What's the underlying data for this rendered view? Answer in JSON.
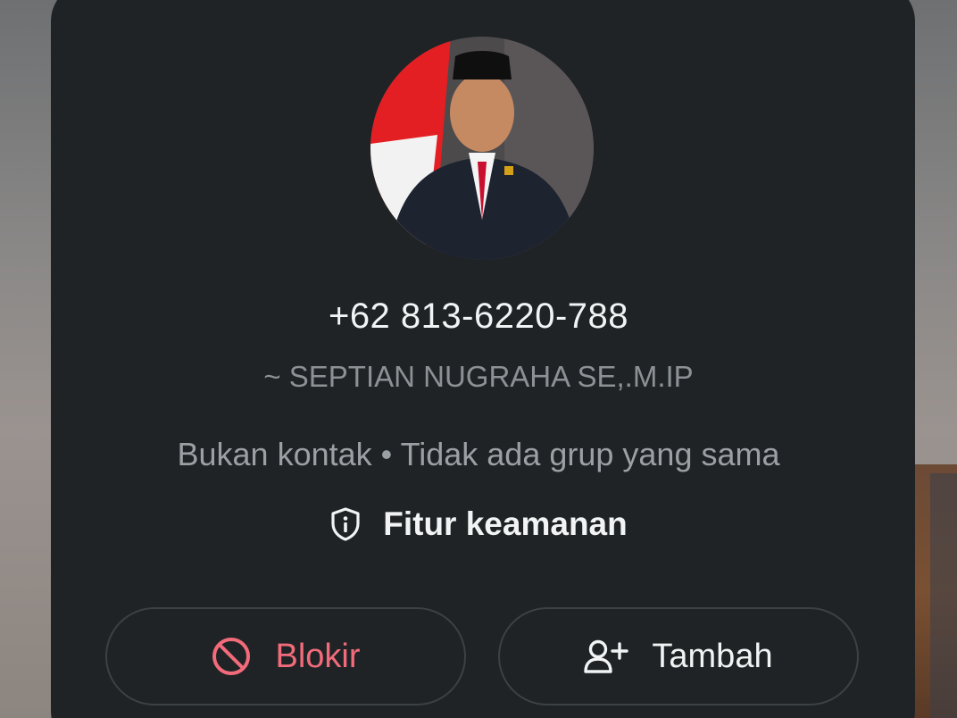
{
  "contact": {
    "phone": "+62 813-6220-788",
    "push_name": "~ SEPTIAN NUGRAHA SE,.M.IP",
    "status_line": "Bukan kontak • Tidak ada grup yang sama"
  },
  "security": {
    "label": "Fitur keamanan",
    "icon": "shield-info-icon"
  },
  "actions": {
    "block_label": "Blokir",
    "block_icon": "block-icon",
    "add_label": "Tambah",
    "add_icon": "add-person-icon"
  },
  "colors": {
    "card_background": "#1f2325",
    "block_accent": "#f26b7b",
    "primary_text": "#f1f3f4",
    "secondary_text": "#9aa0a3"
  }
}
